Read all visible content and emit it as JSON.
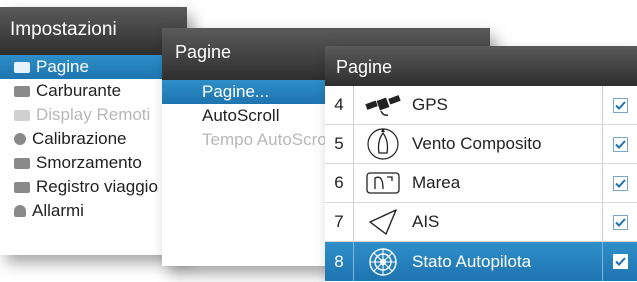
{
  "colors": {
    "accent": "#1e74b0",
    "header": "#3a3a3a",
    "check": "#1e74b0"
  },
  "settings_menu": {
    "title": "Impostazioni",
    "items": [
      {
        "label": "Pagine",
        "icon": "pages-icon",
        "state": "selected"
      },
      {
        "label": "Carburante",
        "icon": "fuel-icon",
        "state": "normal"
      },
      {
        "label": "Display Remoti",
        "icon": "remote-display-icon",
        "state": "disabled"
      },
      {
        "label": "Calibrazione",
        "icon": "calibration-icon",
        "state": "normal"
      },
      {
        "label": "Smorzamento",
        "icon": "damping-icon",
        "state": "normal"
      },
      {
        "label": "Registro viaggio",
        "icon": "trip-log-icon",
        "state": "normal"
      },
      {
        "label": "Allarmi",
        "icon": "alarm-bell-icon",
        "state": "normal"
      }
    ]
  },
  "pages_menu": {
    "title": "Pagine",
    "items": [
      {
        "label": "Pagine...",
        "state": "selected"
      },
      {
        "label": "AutoScroll",
        "state": "normal"
      },
      {
        "label": "Tempo AutoScroll",
        "state": "disabled"
      }
    ]
  },
  "pages_list": {
    "title": "Pagine",
    "rows": [
      {
        "num": "4",
        "label": "GPS",
        "icon": "satellite-icon",
        "checked": true,
        "selected": false
      },
      {
        "num": "5",
        "label": "Vento Composito",
        "icon": "wind-boat-icon",
        "checked": true,
        "selected": false
      },
      {
        "num": "6",
        "label": "Marea",
        "icon": "tide-icon",
        "checked": true,
        "selected": false
      },
      {
        "num": "7",
        "label": "AIS",
        "icon": "ais-triangle-icon",
        "checked": true,
        "selected": false
      },
      {
        "num": "8",
        "label": "Stato Autopilota",
        "icon": "steering-wheel-icon",
        "checked": true,
        "selected": true
      }
    ]
  }
}
